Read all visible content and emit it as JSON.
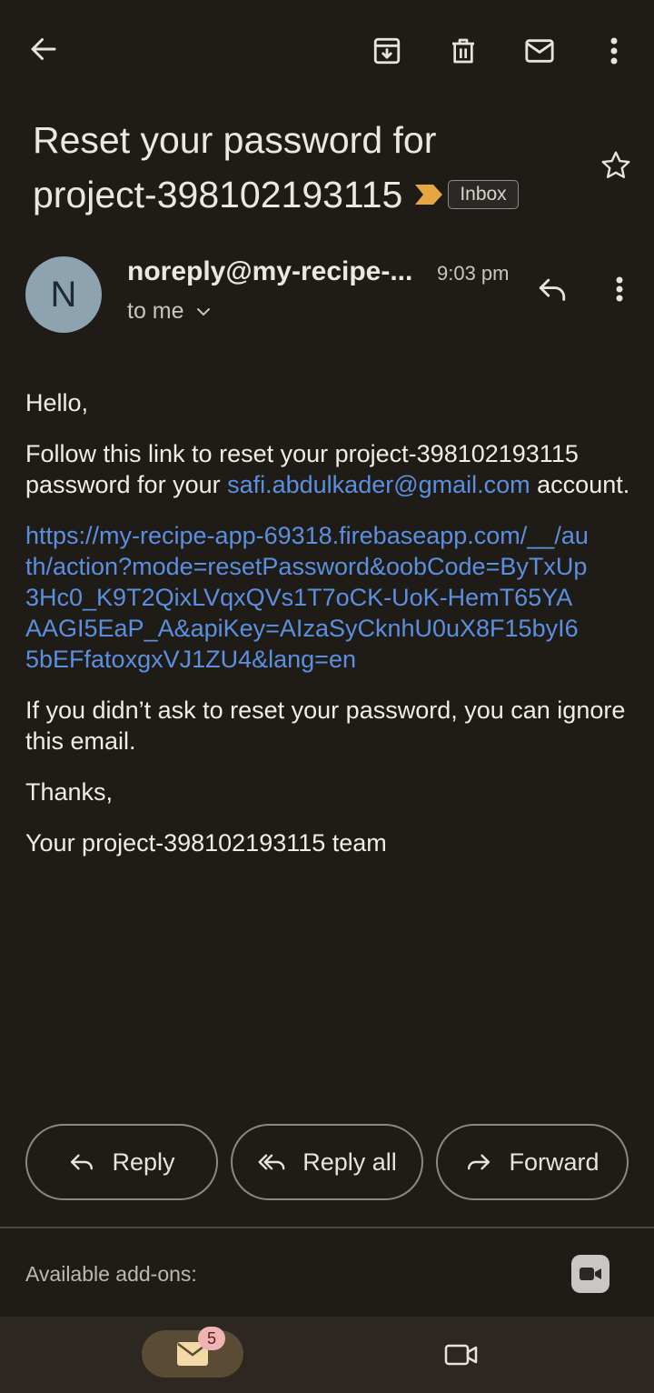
{
  "email": {
    "subject_line1": "Reset your password for",
    "subject_line2": "project-398102193115",
    "label": "Inbox",
    "sender": "noreply@my-recipe-...",
    "time": "9:03 pm",
    "recipient": "to me",
    "avatar_letter": "N",
    "body": {
      "greeting": "Hello,",
      "p1_before": "Follow this link to reset your project-398102193115 password for your ",
      "p1_email": "safi.abdulkader@gmail.com",
      "p1_after": " account.",
      "link": "https://my-recipe-app-69318.firebaseapp.com/__/auth/action?mode=resetPassword&oobCode=ByTxUp3Hc0_K9T2QixLVqxQVs1T7oCK-UoK-HemT65YAAAGI5EaP_A&apiKey=AIzaSyCknhU0uX8F15byI65bEFfatoxgxVJ1ZU4&lang=en",
      "p3": "If you didn’t ask to reset your password, you can ignore this email.",
      "thanks": "Thanks,",
      "signature": "Your project-398102193115 team"
    }
  },
  "actions": {
    "reply": "Reply",
    "reply_all": "Reply all",
    "forward": "Forward"
  },
  "addons": {
    "label": "Available add-ons:"
  },
  "bottom_nav": {
    "mail_badge": "5"
  },
  "colors": {
    "background": "#1f1c18",
    "link": "#5b8fe0",
    "importance_marker": "#e6a740",
    "avatar": "#8ea3b0",
    "badge": "#f0b3b3"
  }
}
